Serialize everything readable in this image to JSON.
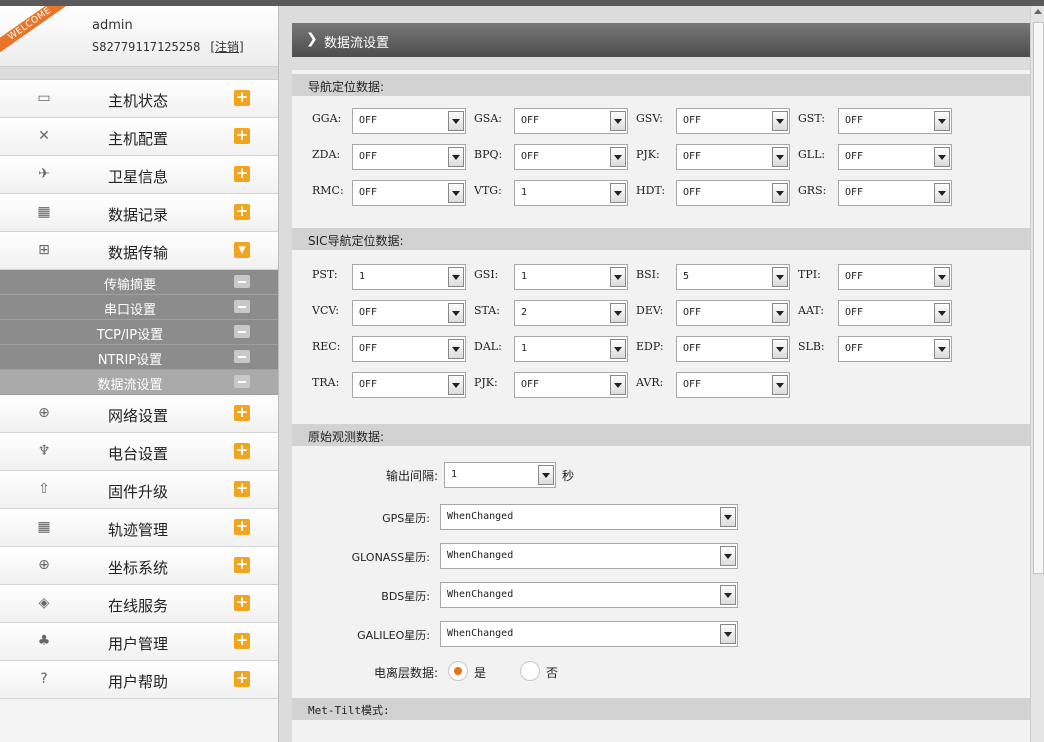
{
  "user": {
    "badge": "WELCOME",
    "name": "admin",
    "serial": "S82779117125258",
    "logout": "[注销]"
  },
  "nav": [
    {
      "label": "主机状态",
      "icon": "monitor-icon",
      "glyph": "▭"
    },
    {
      "label": "主机配置",
      "icon": "tools-icon",
      "glyph": "✕"
    },
    {
      "label": "卫星信息",
      "icon": "satellite-icon",
      "glyph": "✈"
    },
    {
      "label": "数据记录",
      "icon": "calendar-icon",
      "glyph": "▦"
    },
    {
      "label": "数据传输",
      "icon": "network-icon",
      "glyph": "⊞"
    }
  ],
  "sub": [
    "传输摘要",
    "串口设置",
    "TCP/IP设置",
    "NTRIP设置",
    "数据流设置"
  ],
  "nav2": [
    {
      "label": "网络设置",
      "icon": "globe-icon",
      "glyph": "⊕"
    },
    {
      "label": "电台设置",
      "icon": "radio-antenna-icon",
      "glyph": "♆"
    },
    {
      "label": "固件升级",
      "icon": "upload-icon",
      "glyph": "⇧"
    },
    {
      "label": "轨迹管理",
      "icon": "calendar-icon",
      "glyph": "▦"
    },
    {
      "label": "坐标系统",
      "icon": "globe-icon",
      "glyph": "⊕"
    },
    {
      "label": "在线服务",
      "icon": "cube-icon",
      "glyph": "◈"
    },
    {
      "label": "用户管理",
      "icon": "users-icon",
      "glyph": "♣"
    },
    {
      "label": "用户帮助",
      "icon": "help-icon",
      "glyph": "?"
    }
  ],
  "page_title": "数据流设置",
  "sections": {
    "nav_data": "导航定位数据:",
    "sic_data": "SIC导航定位数据:",
    "raw_data": "原始观测数据:",
    "met_tilt": "Met-Tilt模式:"
  },
  "nav_fields": [
    [
      "GGA:",
      "OFF"
    ],
    [
      "GSA:",
      "OFF"
    ],
    [
      "GSV:",
      "OFF"
    ],
    [
      "GST:",
      "OFF"
    ],
    [
      "ZDA:",
      "OFF"
    ],
    [
      "BPQ:",
      "OFF"
    ],
    [
      "PJK:",
      "OFF"
    ],
    [
      "GLL:",
      "OFF"
    ],
    [
      "RMC:",
      "OFF"
    ],
    [
      "VTG:",
      "1"
    ],
    [
      "HDT:",
      "OFF"
    ],
    [
      "GRS:",
      "OFF"
    ]
  ],
  "sic_fields": [
    [
      "PST:",
      "1"
    ],
    [
      "GSI:",
      "1"
    ],
    [
      "BSI:",
      "5"
    ],
    [
      "TPI:",
      "OFF"
    ],
    [
      "VCV:",
      "OFF"
    ],
    [
      "STA:",
      "2"
    ],
    [
      "DEV:",
      "OFF"
    ],
    [
      "AAT:",
      "OFF"
    ],
    [
      "REC:",
      "OFF"
    ],
    [
      "DAL:",
      "1"
    ],
    [
      "EDP:",
      "OFF"
    ],
    [
      "SLB:",
      "OFF"
    ],
    [
      "TRA:",
      "OFF"
    ],
    [
      "PJK:",
      "OFF"
    ],
    [
      "AVR:",
      "OFF"
    ]
  ],
  "raw": {
    "interval_label": "输出间隔:",
    "interval_value": "1",
    "interval_unit": "秒",
    "gps_label": "GPS星历:",
    "gps_value": "WhenChanged",
    "glonass_label": "GLONASS星历:",
    "glonass_value": "WhenChanged",
    "bds_label": "BDS星历:",
    "bds_value": "WhenChanged",
    "galileo_label": "GALILEO星历:",
    "galileo_value": "WhenChanged",
    "iono_label": "电离层数据:",
    "iono_yes": "是",
    "iono_no": "否",
    "iono_selected": "是"
  }
}
